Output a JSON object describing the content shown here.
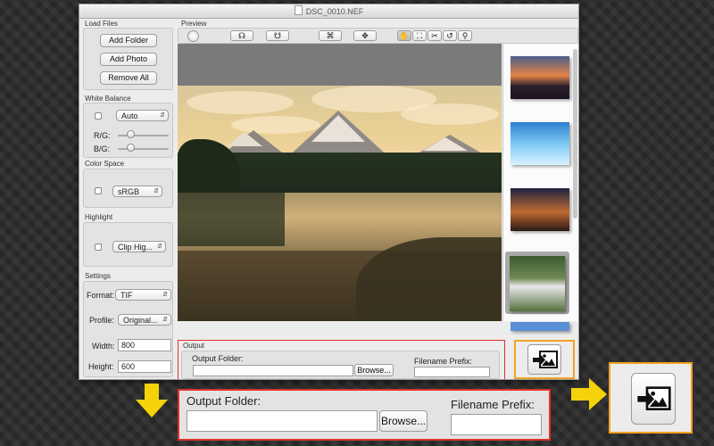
{
  "window": {
    "title": "DSC_0010.NEF"
  },
  "load_files": {
    "title": "Load Files",
    "add_folder": "Add Folder",
    "add_photo": "Add Photo",
    "remove_all": "Remove All"
  },
  "white_balance": {
    "title": "White Balance",
    "mode": "Auto",
    "rg_label": "R/G:",
    "bg_label": "B/G:",
    "rg_level": 0.25,
    "bg_level": 0.25
  },
  "color_space": {
    "title": "Color Space",
    "value": "sRGB"
  },
  "highlight": {
    "title": "Highlight",
    "value": "Clip Hig..."
  },
  "settings": {
    "title": "Settings",
    "format_label": "Format:",
    "format_value": "TIF",
    "profile_label": "Profile:",
    "profile_value": "Original...",
    "width_label": "Width:",
    "width_value": "800",
    "height_label": "Height:",
    "height_value": "600"
  },
  "preview": {
    "title": "Preview"
  },
  "toolbar": {
    "icons": [
      "circle-icon",
      "rotate-left-icon",
      "rotate-right-icon",
      "crop-icon",
      "fit-icon",
      "hand-icon",
      "fullscreen-icon",
      "scissors-icon",
      "undo-icon",
      "zoom-icon"
    ]
  },
  "output": {
    "title": "Output",
    "folder_label": "Output Folder:",
    "folder_value": "",
    "browse_label": "Browse...",
    "prefix_label": "Filename Prefix:",
    "prefix_value": ""
  },
  "zoom_callout": {
    "folder_label": "Output Folder:",
    "browse_label": "Browse...",
    "prefix_label": "Filename Prefix:"
  },
  "colors": {
    "accent_red": "#e0322b",
    "accent_orange": "#f2a324",
    "arrow_yellow": "#f5d20a"
  }
}
